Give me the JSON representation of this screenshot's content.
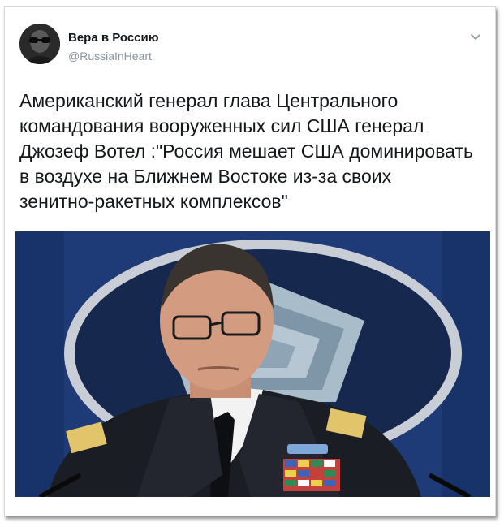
{
  "tweet": {
    "author_name": "Вера в Россию",
    "author_handle": "@RussiaInHeart",
    "text": "Американский генерал глава Центрального\nкомандования вооруженных сил США генерал\nДжозеф Вотел :\"Россия мешает США доминировать\nв воздухе на Ближнем Востоке из-за своих\nзенитно-ракетных комплексов\"",
    "more_icon": "chevron-down-icon",
    "avatar_icon": "avatar"
  },
  "photo": {
    "subject": "general-photo"
  },
  "colors": {
    "name": "#14171a",
    "handle": "#8a949e",
    "photo_bg": "#1f3d7a"
  }
}
